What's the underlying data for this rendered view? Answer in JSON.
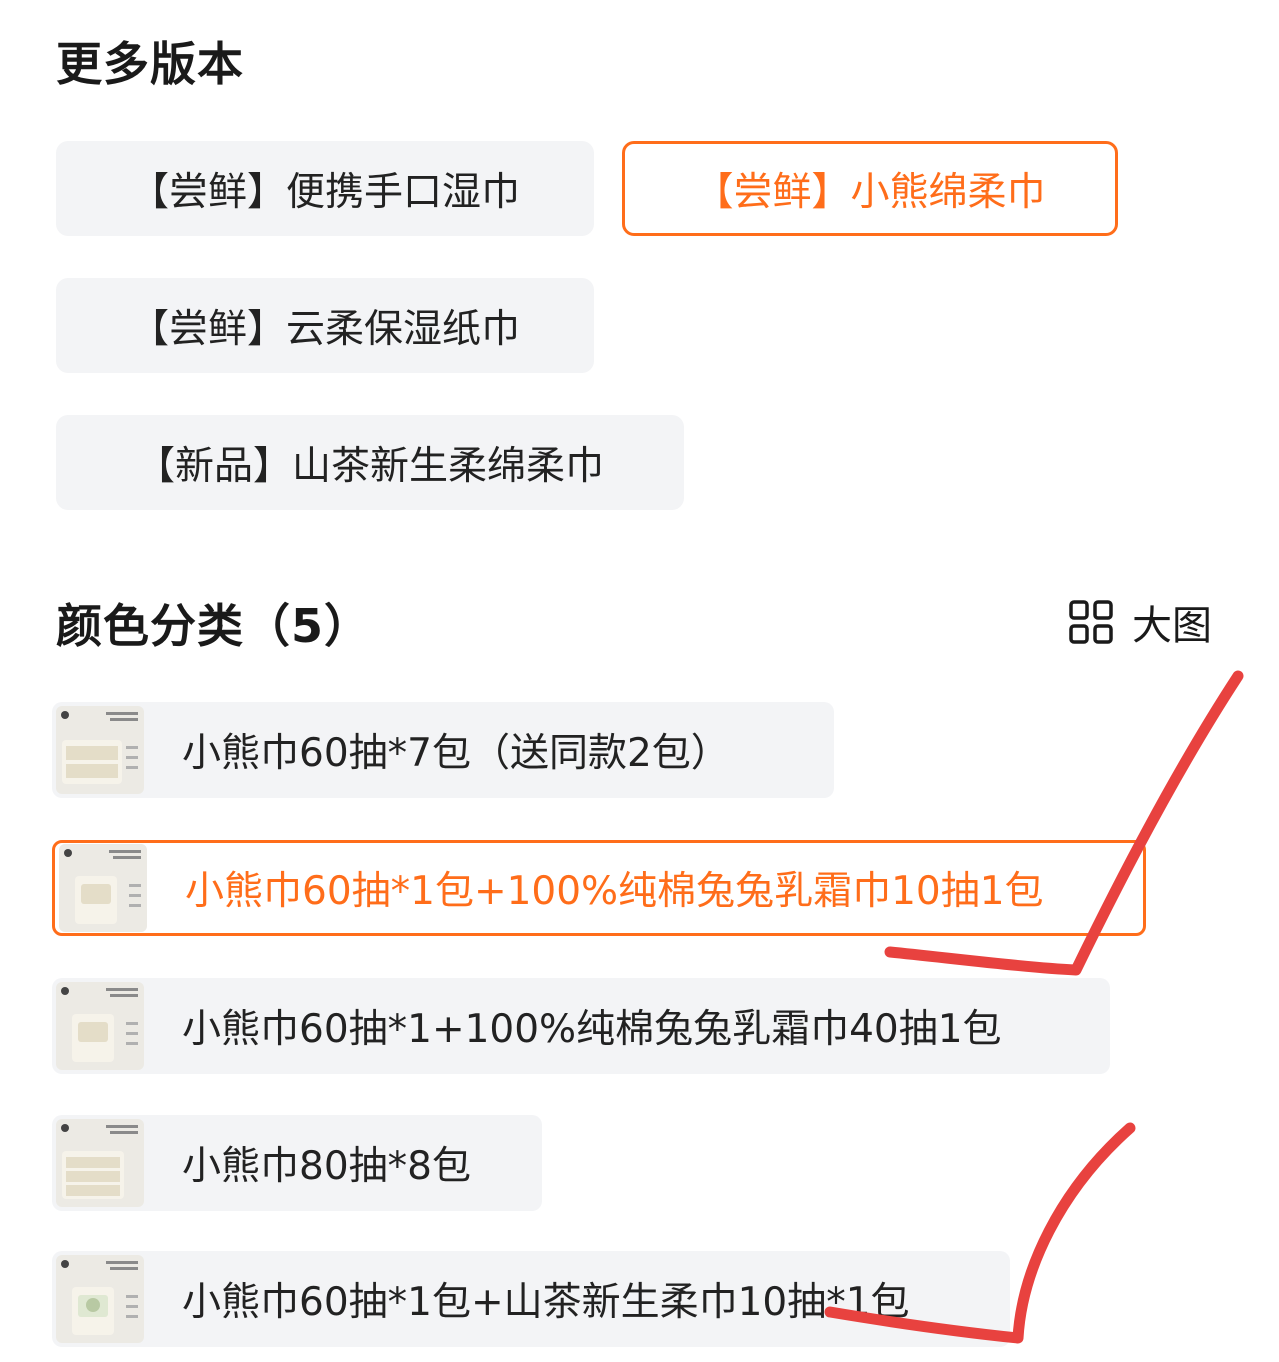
{
  "versions": {
    "title": "更多版本",
    "items": [
      {
        "label": "【尝鲜】便携手口湿巾",
        "selected": false
      },
      {
        "label": "【尝鲜】小熊绵柔巾",
        "selected": true
      },
      {
        "label": "【尝鲜】云柔保湿纸巾",
        "selected": false
      },
      {
        "label": "【新品】山茶新生柔绵柔巾",
        "selected": false
      }
    ]
  },
  "colors": {
    "title": "颜色分类（5）",
    "view_toggle": {
      "icon": "grid-icon",
      "label": "大图"
    },
    "items": [
      {
        "label": "小熊巾60抽*7包（送同款2包）",
        "selected": false,
        "thumb_text": "云朵般柔软\n面膜级*柔巾"
      },
      {
        "label": "小熊巾60抽*1包+100%纯棉兔兔乳霜巾10抽1包",
        "selected": true,
        "thumb_text": "云朵般柔软\n面膜级*柔巾"
      },
      {
        "label": "小熊巾60抽*1+100%纯棉兔兔乳霜巾40抽1包",
        "selected": false,
        "thumb_text": "云朵般柔软\n面膜级*柔巾"
      },
      {
        "label": "小熊巾80抽*8包",
        "selected": false,
        "thumb_text": "云朵般柔软\n面膜级*柔巾"
      },
      {
        "label": "小熊巾60抽*1包+山茶新生柔巾10抽*1包",
        "selected": false,
        "thumb_text": "云朵般柔软\n面膜级*柔巾"
      }
    ]
  },
  "theme": {
    "accent": "#ff6d1a",
    "chip_bg": "#f3f4f6",
    "annotation_mark": "#e8423f"
  }
}
